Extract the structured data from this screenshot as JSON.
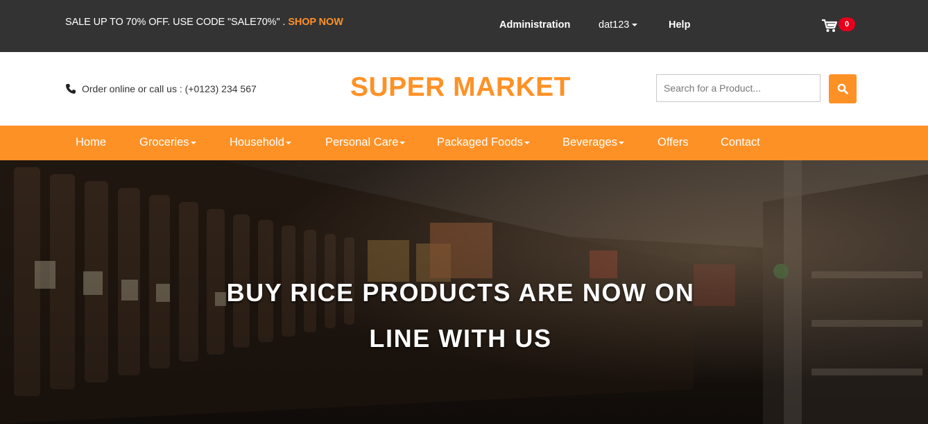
{
  "topbar": {
    "promo_text": "SALE UP TO 70% OFF. USE CODE \"SALE70%\" .",
    "promo_link": "SHOP NOW",
    "admin_label": "Administration",
    "user_label": "dat123",
    "help_label": "Help",
    "cart_count": "0"
  },
  "header": {
    "contact_text": "Order online or call us : (+0123) 234 567",
    "logo": "SUPER MARKET",
    "search_placeholder": "Search for a Product..."
  },
  "nav": {
    "items": [
      {
        "label": "Home"
      },
      {
        "label": "Groceries"
      },
      {
        "label": "Household"
      },
      {
        "label": "Personal Care"
      },
      {
        "label": "Packaged Foods"
      },
      {
        "label": "Beverages"
      },
      {
        "label": "Offers"
      },
      {
        "label": "Contact"
      }
    ]
  },
  "hero": {
    "line1": "BUY RICE PRODUCTS ARE NOW ON",
    "line2": "LINE WITH US"
  },
  "colors": {
    "accent": "#fe9126",
    "topbar_bg": "#333333",
    "badge": "#e5001b"
  }
}
